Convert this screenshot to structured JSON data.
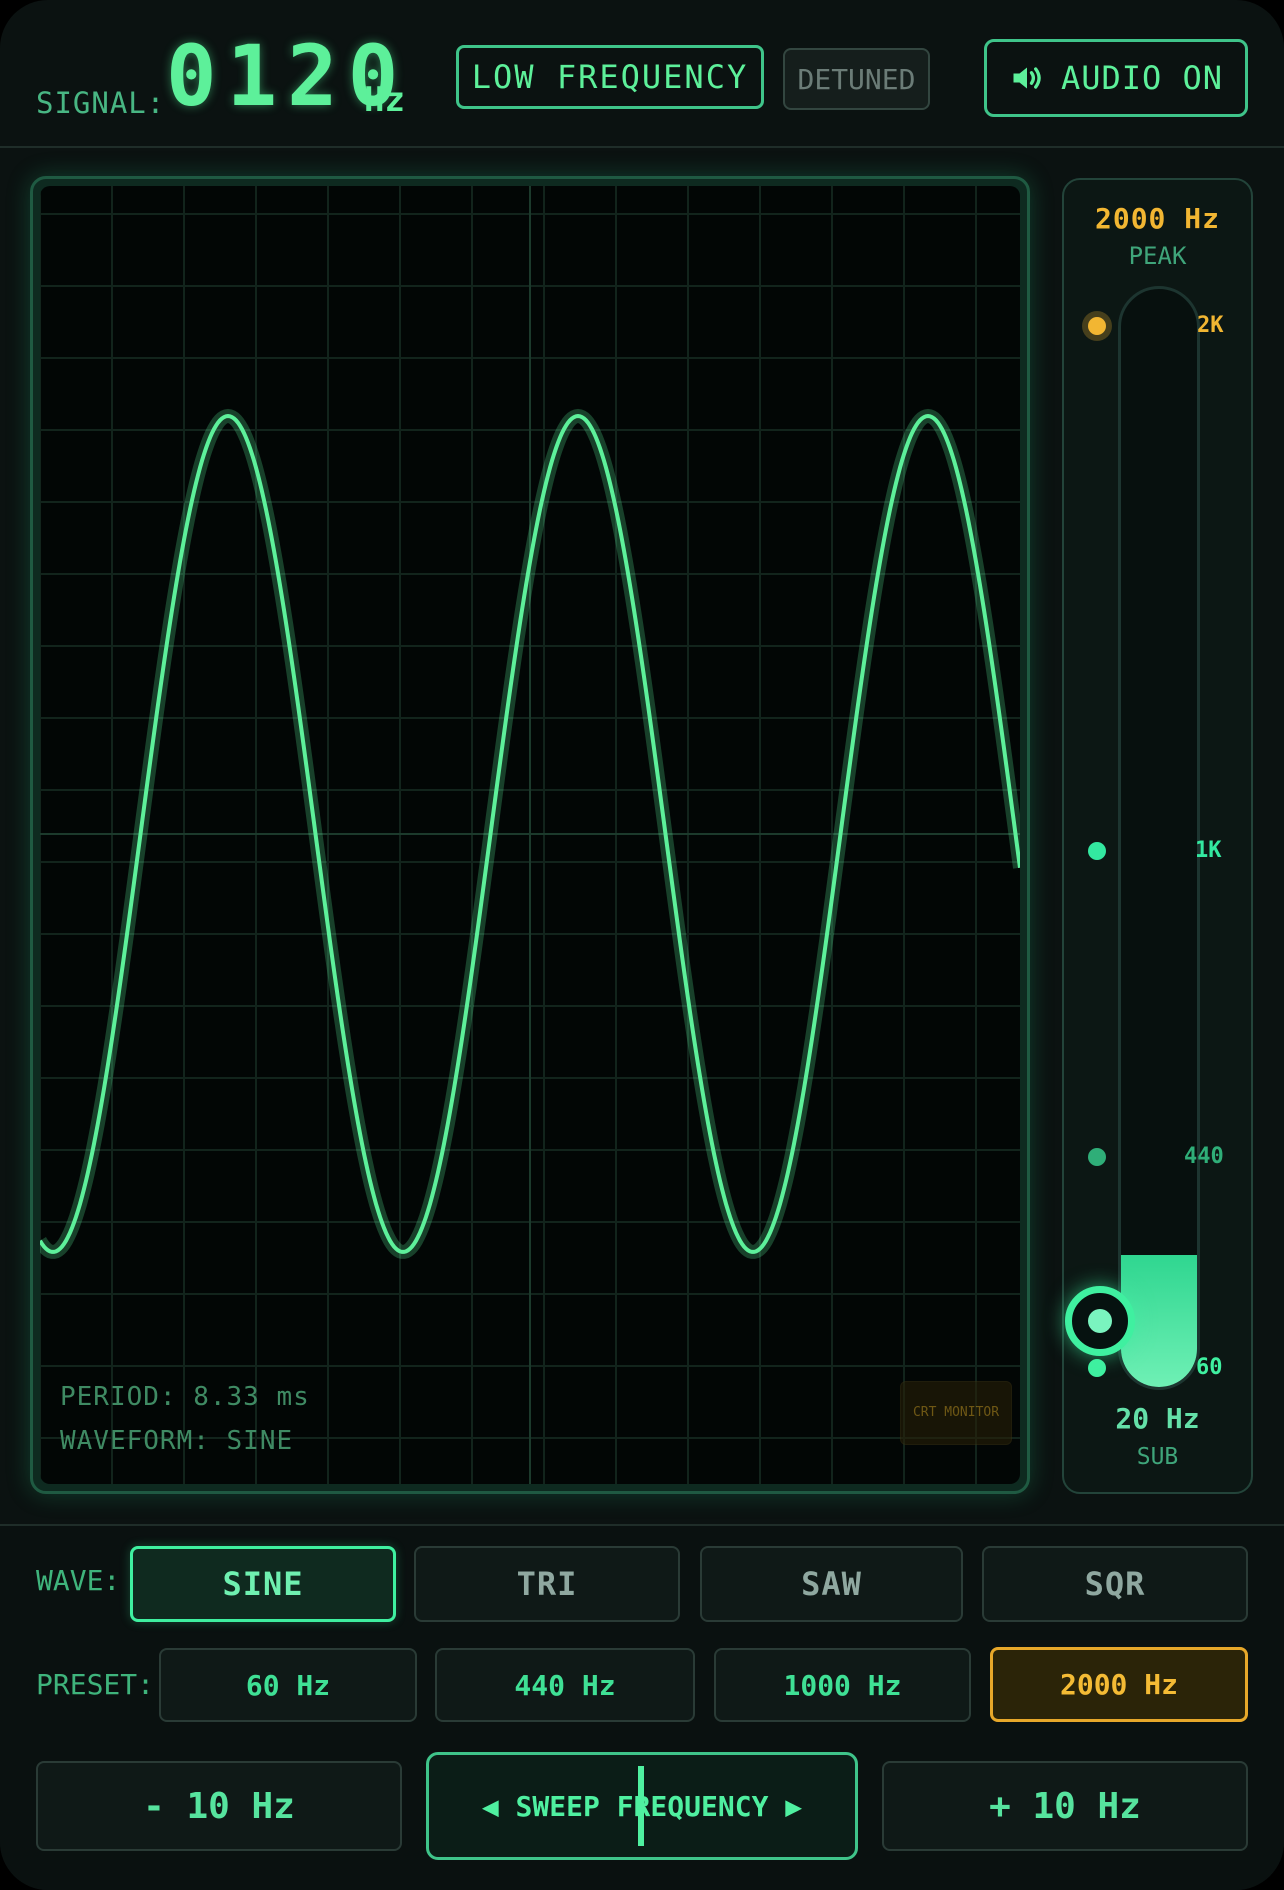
{
  "header": {
    "signal_label": "SIGNAL:",
    "signal_value": "0120",
    "signal_unit": "Hz",
    "band_badge": "LOW FREQUENCY",
    "detune_badge": "DETUNED",
    "audio_button": "AUDIO ON",
    "audio_icon": "speaker-icon"
  },
  "scope": {
    "period_label": "PERIOD: 8.33 ms",
    "waveform_label": "WAVEFORM: SINE",
    "badge_text": "CRT MONITOR",
    "trace_color": "#5df09a",
    "waveform": "sine",
    "cycles_visible": 2.8
  },
  "slider": {
    "peak_value": "2000 Hz",
    "peak_label": "PEAK",
    "sub_value": "20 Hz",
    "sub_label": "SUB",
    "ticks": [
      {
        "label": "2K",
        "color": "#f2b632"
      },
      {
        "label": "1K",
        "color": "#33e8a0"
      },
      {
        "label": "440",
        "color": "#2fae78"
      },
      {
        "label": "60",
        "color": "#3ff0a0"
      }
    ],
    "current_value_hz": 120
  },
  "controls": {
    "wave_label": "WAVE:",
    "waves": [
      "SINE",
      "TRI",
      "SAW",
      "SQR"
    ],
    "active_wave": "SINE",
    "preset_label": "PRESET:",
    "presets": [
      "60 Hz",
      "440 Hz",
      "1000 Hz",
      "2000 Hz"
    ],
    "highlighted_preset": "2000 Hz",
    "step_down": "- 10 Hz",
    "sweep": "◀ SWEEP FREQUENCY ▶",
    "step_up": "+ 10 Hz"
  },
  "colors": {
    "accent": "#3ff0a0",
    "gold": "#f2b632",
    "background": "#0b1211"
  }
}
